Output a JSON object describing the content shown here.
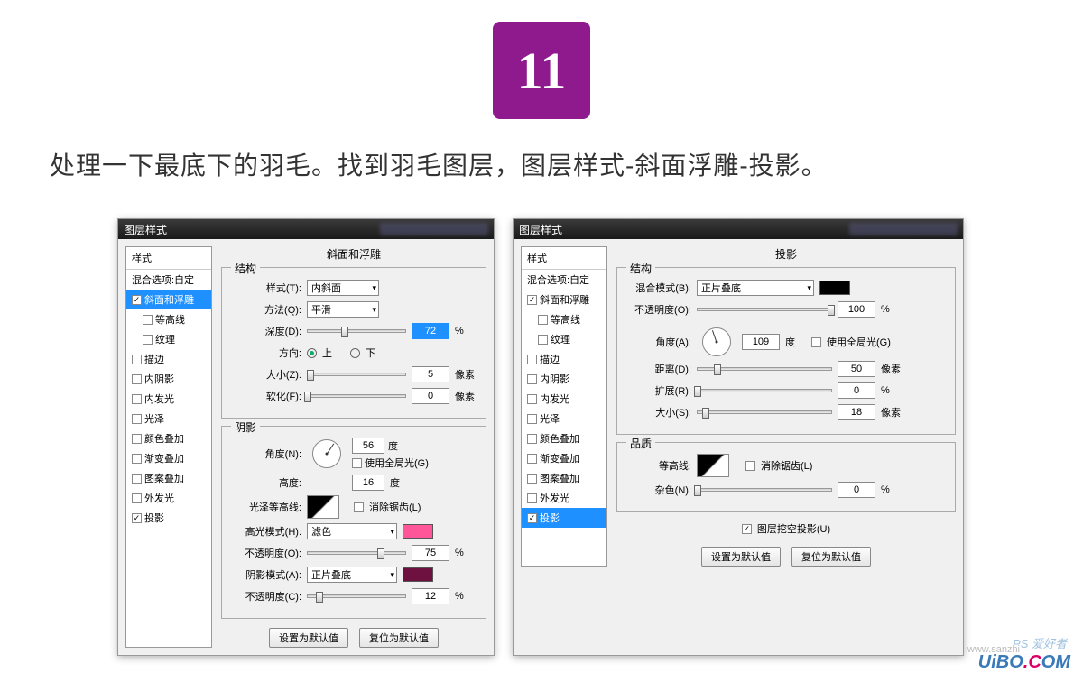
{
  "step": "11",
  "instruction": "处理一下最底下的羽毛。找到羽毛图层，图层样式-斜面浮雕-投影。",
  "dialog1": {
    "title": "图层样式",
    "sidebar": {
      "head": "样式",
      "blend": "混合选项:自定",
      "items": [
        {
          "label": "斜面和浮雕",
          "checked": true,
          "active": true
        },
        {
          "label": "等高线",
          "checked": false,
          "sub": true
        },
        {
          "label": "纹理",
          "checked": false,
          "sub": true
        },
        {
          "label": "描边",
          "checked": false
        },
        {
          "label": "内阴影",
          "checked": false
        },
        {
          "label": "内发光",
          "checked": false
        },
        {
          "label": "光泽",
          "checked": false
        },
        {
          "label": "颜色叠加",
          "checked": false
        },
        {
          "label": "渐变叠加",
          "checked": false
        },
        {
          "label": "图案叠加",
          "checked": false
        },
        {
          "label": "外发光",
          "checked": false
        },
        {
          "label": "投影",
          "checked": true
        }
      ]
    },
    "section_title": "斜面和浮雕",
    "struct_title": "结构",
    "style_label": "样式(T):",
    "style_value": "内斜面",
    "method_label": "方法(Q):",
    "method_value": "平滑",
    "depth_label": "深度(D):",
    "depth_value": "72",
    "depth_unit": "%",
    "dir_label": "方向:",
    "dir_up": "上",
    "dir_down": "下",
    "size_label": "大小(Z):",
    "size_value": "5",
    "size_unit": "像素",
    "soften_label": "软化(F):",
    "soften_value": "0",
    "soften_unit": "像素",
    "shade_title": "阴影",
    "angle_label": "角度(N):",
    "angle_value": "56",
    "angle_unit": "度",
    "global_label": "使用全局光(G)",
    "alt_label": "高度:",
    "alt_value": "16",
    "alt_unit": "度",
    "gloss_label": "光泽等高线:",
    "anti_label": "消除锯齿(L)",
    "hi_mode_label": "高光模式(H):",
    "hi_mode_value": "滤色",
    "hi_op_label": "不透明度(O):",
    "hi_op_value": "75",
    "hi_op_unit": "%",
    "sh_mode_label": "阴影模式(A):",
    "sh_mode_value": "正片叠底",
    "sh_op_label": "不透明度(C):",
    "sh_op_value": "12",
    "sh_op_unit": "%",
    "btn_default": "设置为默认值",
    "btn_reset": "复位为默认值",
    "hi_color": "#ff5599",
    "sh_color": "#6e1040"
  },
  "dialog2": {
    "title": "图层样式",
    "sidebar": {
      "head": "样式",
      "blend": "混合选项:自定",
      "items": [
        {
          "label": "斜面和浮雕",
          "checked": true
        },
        {
          "label": "等高线",
          "checked": false,
          "sub": true
        },
        {
          "label": "纹理",
          "checked": false,
          "sub": true
        },
        {
          "label": "描边",
          "checked": false
        },
        {
          "label": "内阴影",
          "checked": false
        },
        {
          "label": "内发光",
          "checked": false
        },
        {
          "label": "光泽",
          "checked": false
        },
        {
          "label": "颜色叠加",
          "checked": false
        },
        {
          "label": "渐变叠加",
          "checked": false
        },
        {
          "label": "图案叠加",
          "checked": false
        },
        {
          "label": "外发光",
          "checked": false
        },
        {
          "label": "投影",
          "checked": true,
          "active": true
        }
      ]
    },
    "section_title": "投影",
    "struct_title": "结构",
    "blend_label": "混合模式(B):",
    "blend_value": "正片叠底",
    "op_label": "不透明度(O):",
    "op_value": "100",
    "op_unit": "%",
    "angle_label": "角度(A):",
    "angle_value": "109",
    "angle_unit": "度",
    "global_label": "使用全局光(G)",
    "dist_label": "距离(D):",
    "dist_value": "50",
    "dist_unit": "像素",
    "spread_label": "扩展(R):",
    "spread_value": "0",
    "spread_unit": "%",
    "size_label": "大小(S):",
    "size_value": "18",
    "size_unit": "像素",
    "qual_title": "品质",
    "contour_label": "等高线:",
    "anti_label": "消除锯齿(L)",
    "noise_label": "杂色(N):",
    "noise_value": "0",
    "noise_unit": "%",
    "knockout_label": "图层挖空投影(U)",
    "btn_default": "设置为默认值",
    "btn_reset": "复位为默认值",
    "shadow_color": "#000000"
  },
  "watermark": {
    "ps": "PS 爱好者",
    "url": "www.sanzhi",
    "brand": "UiBO",
    "dot": ".C",
    "om": "OM"
  }
}
